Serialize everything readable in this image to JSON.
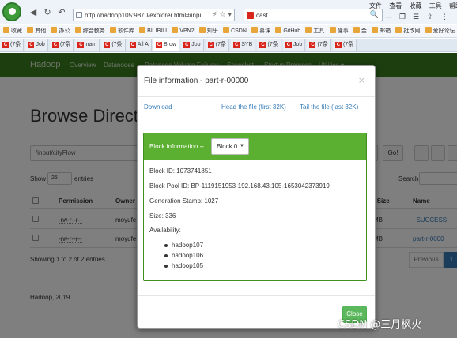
{
  "browser": {
    "url": "http://hadoop105:9870/explorer.html#/inpu",
    "search_text": "cast",
    "url_tools": "⚡ ☆ ▾",
    "search_glass": "🔍",
    "menu": [
      "文件",
      "查看",
      "收藏",
      "工具",
      "帮助"
    ],
    "bookmarks": [
      "收藏",
      "其他",
      "办公",
      "综合教务",
      "软件库",
      "BILIBILI",
      "VPN2",
      "知乎",
      "CSDN",
      "慕课",
      "GitHub",
      "工具",
      "懂事",
      "金",
      "邮箱",
      "批改网",
      "爱好论坛"
    ],
    "tabs": [
      {
        "icon": "C",
        "label": "(7条"
      },
      {
        "icon": "C",
        "label": "Job"
      },
      {
        "icon": "C",
        "label": "(7条"
      },
      {
        "icon": "C",
        "label": "nam"
      },
      {
        "icon": "C",
        "label": "(7条"
      },
      {
        "icon": "C",
        "label": "All A"
      },
      {
        "icon": "C",
        "label": "Brow"
      },
      {
        "icon": "C",
        "label": "Job"
      },
      {
        "icon": "C",
        "label": "(7条"
      },
      {
        "icon": "C",
        "label": "SYB"
      },
      {
        "icon": "C",
        "label": "(7条"
      },
      {
        "icon": "C",
        "label": "Job"
      },
      {
        "icon": "C",
        "label": "(7条"
      },
      {
        "icon": "C",
        "label": "(7条"
      }
    ]
  },
  "hadoop": {
    "brand": "Hadoop",
    "nav": [
      "Overview",
      "Datanodes",
      "Datanode Volume Failures",
      "Snapshot",
      "Startup Progress",
      "Utilities ▾"
    ],
    "heading": "Browse Directory",
    "path": "/input/cityFlow",
    "go": "Go!",
    "show_label": "Show",
    "show_value": "25",
    "entries_label": "entries",
    "search_label": "Search:",
    "columns": [
      "Permission",
      "Owner",
      "k Size",
      "Name"
    ],
    "rows": [
      {
        "permission": "-rw-r--r--",
        "owner": "moyufe",
        "size": "MB",
        "name": "_SUCCESS"
      },
      {
        "permission": "-rw-r--r--",
        "owner": "moyufe",
        "size": "MB",
        "name": "part-r-0000"
      }
    ],
    "showing": "Showing 1 to 2 of 2 entries",
    "previous": "Previous",
    "page": "1",
    "footer": "Hadoop, 2019."
  },
  "modal": {
    "title": "File information - part-r-00000",
    "close_x": "×",
    "download": "Download",
    "head": "Head the file (first 32K)",
    "tail": "Tail the file (last 32K)",
    "block_label": "Block information --",
    "block_value": "Block 0",
    "block_id": "Block ID: 1073741851",
    "pool_id": "Block Pool ID: BP-1119151953-192.168.43.105-1653042373919",
    "gen_stamp": "Generation Stamp: 1027",
    "size": "Size: 336",
    "availability_label": "Availability:",
    "nodes": [
      "hadoop107",
      "hadoop106",
      "hadoop105"
    ],
    "close_button": "Close"
  },
  "watermark": "CSDN @三月枫火"
}
